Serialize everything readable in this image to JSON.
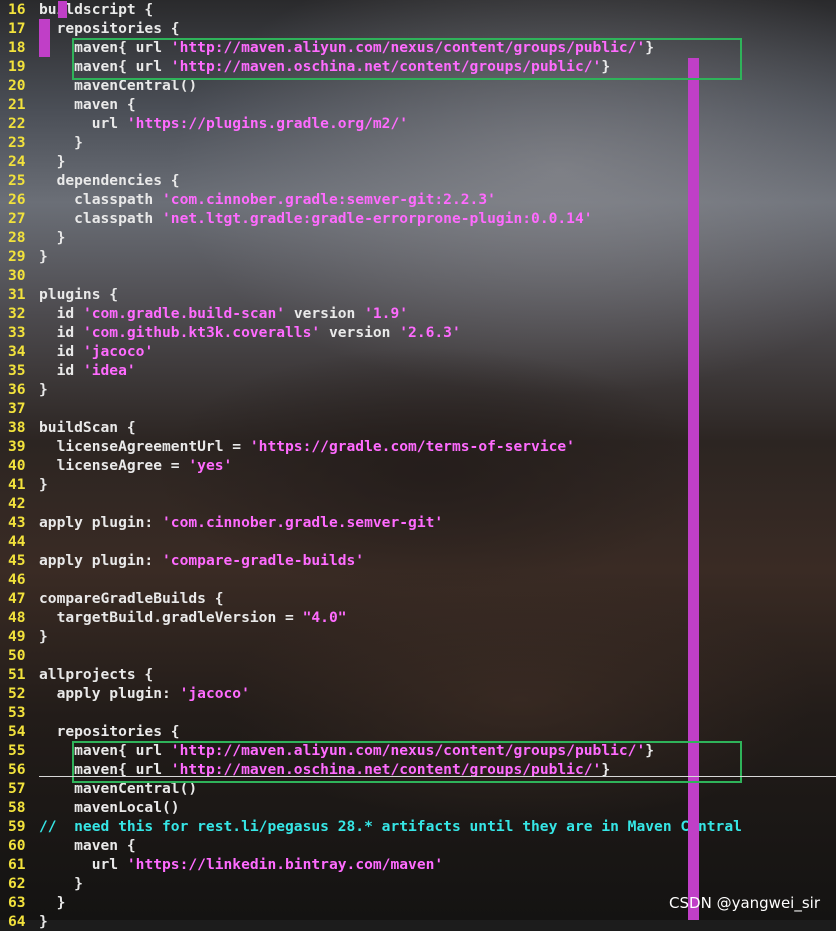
{
  "editor": {
    "lines": [
      {
        "num": "16",
        "text": "buildscript {"
      },
      {
        "num": "17",
        "text": "  repositories {"
      },
      {
        "num": "18",
        "text": "    maven{ url 'http://maven.aliyun.com/nexus/content/groups/public/'}"
      },
      {
        "num": "19",
        "text": "    maven{ url 'http://maven.oschina.net/content/groups/public/'}"
      },
      {
        "num": "20",
        "text": "    mavenCentral()"
      },
      {
        "num": "21",
        "text": "    maven {"
      },
      {
        "num": "22",
        "text": "      url 'https://plugins.gradle.org/m2/'"
      },
      {
        "num": "23",
        "text": "    }"
      },
      {
        "num": "24",
        "text": "  }"
      },
      {
        "num": "25",
        "text": "  dependencies {"
      },
      {
        "num": "26",
        "text": "    classpath 'com.cinnober.gradle:semver-git:2.2.3'"
      },
      {
        "num": "27",
        "text": "    classpath 'net.ltgt.gradle:gradle-errorprone-plugin:0.0.14'"
      },
      {
        "num": "28",
        "text": "  }"
      },
      {
        "num": "29",
        "text": "}"
      },
      {
        "num": "30",
        "text": ""
      },
      {
        "num": "31",
        "text": "plugins {"
      },
      {
        "num": "32",
        "text": "  id 'com.gradle.build-scan' version '1.9'"
      },
      {
        "num": "33",
        "text": "  id 'com.github.kt3k.coveralls' version '2.6.3'"
      },
      {
        "num": "34",
        "text": "  id 'jacoco'"
      },
      {
        "num": "35",
        "text": "  id 'idea'"
      },
      {
        "num": "36",
        "text": "}"
      },
      {
        "num": "37",
        "text": ""
      },
      {
        "num": "38",
        "text": "buildScan {"
      },
      {
        "num": "39",
        "text": "  licenseAgreementUrl = 'https://gradle.com/terms-of-service'"
      },
      {
        "num": "40",
        "text": "  licenseAgree = 'yes'"
      },
      {
        "num": "41",
        "text": "}"
      },
      {
        "num": "42",
        "text": ""
      },
      {
        "num": "43",
        "text": "apply plugin: 'com.cinnober.gradle.semver-git'"
      },
      {
        "num": "44",
        "text": ""
      },
      {
        "num": "45",
        "text": "apply plugin: 'compare-gradle-builds'"
      },
      {
        "num": "46",
        "text": ""
      },
      {
        "num": "47",
        "text": "compareGradleBuilds {"
      },
      {
        "num": "48",
        "text": "  targetBuild.gradleVersion = \"4.0\""
      },
      {
        "num": "49",
        "text": "}"
      },
      {
        "num": "50",
        "text": ""
      },
      {
        "num": "51",
        "text": "allprojects {"
      },
      {
        "num": "52",
        "text": "  apply plugin: 'jacoco'"
      },
      {
        "num": "53",
        "text": ""
      },
      {
        "num": "54",
        "text": "  repositories {"
      },
      {
        "num": "55",
        "text": "    maven{ url 'http://maven.aliyun.com/nexus/content/groups/public/'}"
      },
      {
        "num": "56",
        "text": "    maven{ url 'http://maven.oschina.net/content/groups/public/'}"
      },
      {
        "num": "57",
        "text": "    mavenCentral()"
      },
      {
        "num": "58",
        "text": "    mavenLocal()"
      },
      {
        "num": "59",
        "text": "//  need this for rest.li/pegasus 28.* artifacts until they are in Maven Central"
      },
      {
        "num": "60",
        "text": "    maven {"
      },
      {
        "num": "61",
        "text": "      url 'https://linkedin.bintray.com/maven'"
      },
      {
        "num": "62",
        "text": "    }"
      },
      {
        "num": "63",
        "text": "  }"
      },
      {
        "num": "64",
        "text": "}"
      }
    ]
  },
  "watermark": "CSDN @yangwei_sir",
  "colors": {
    "line_number": "#f2e23c",
    "code": "#e9e9e9",
    "string": "#ff6bff",
    "comment": "#36e6e6",
    "highlight_box": "#2fb35a",
    "cursor_bar": "#c03fc7"
  }
}
